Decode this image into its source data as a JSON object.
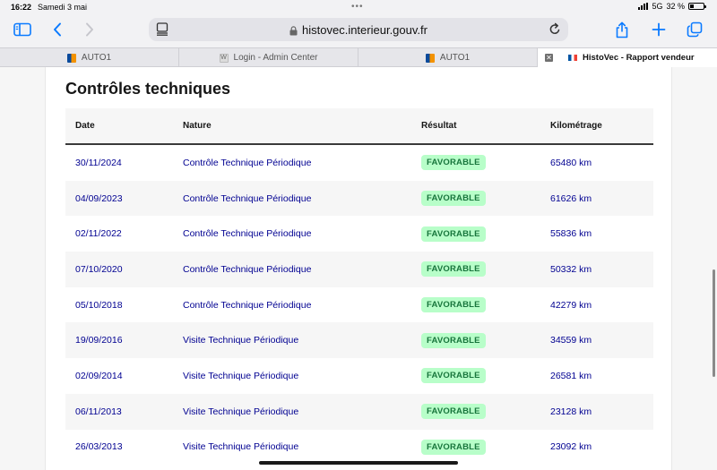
{
  "status": {
    "time": "16:22",
    "date": "Samedi 3 mai",
    "network": "5G",
    "battery": "32 %",
    "battery_level": 0.32
  },
  "address_bar": {
    "url": "histovec.interieur.gouv.fr"
  },
  "tabs": [
    {
      "label": "AUTO1"
    },
    {
      "label": "Login - Admin Center"
    },
    {
      "label": "AUTO1"
    },
    {
      "label": "HistoVec - Rapport vendeur"
    }
  ],
  "section": {
    "title": "Contrôles techniques"
  },
  "table": {
    "headers": {
      "date": "Date",
      "nature": "Nature",
      "result": "Résultat",
      "mileage": "Kilométrage"
    },
    "rows": [
      {
        "date": "30/11/2024",
        "nature": "Contrôle Technique Périodique",
        "result": "FAVORABLE",
        "mileage": "65480 km"
      },
      {
        "date": "04/09/2023",
        "nature": "Contrôle Technique Périodique",
        "result": "FAVORABLE",
        "mileage": "61626 km"
      },
      {
        "date": "02/11/2022",
        "nature": "Contrôle Technique Périodique",
        "result": "FAVORABLE",
        "mileage": "55836 km"
      },
      {
        "date": "07/10/2020",
        "nature": "Contrôle Technique Périodique",
        "result": "FAVORABLE",
        "mileage": "50332 km"
      },
      {
        "date": "05/10/2018",
        "nature": "Contrôle Technique Périodique",
        "result": "FAVORABLE",
        "mileage": "42279 km"
      },
      {
        "date": "19/09/2016",
        "nature": "Visite Technique Périodique",
        "result": "FAVORABLE",
        "mileage": "34559 km"
      },
      {
        "date": "02/09/2014",
        "nature": "Visite Technique Périodique",
        "result": "FAVORABLE",
        "mileage": "26581 km"
      },
      {
        "date": "06/11/2013",
        "nature": "Visite Technique Périodique",
        "result": "FAVORABLE",
        "mileage": "23128 km"
      },
      {
        "date": "26/03/2013",
        "nature": "Visite Technique Périodique",
        "result": "FAVORABLE",
        "mileage": "23092 km"
      }
    ]
  },
  "colors": {
    "accent": "#0a7aff",
    "link": "#000091",
    "badge_bg": "#b8fec9",
    "badge_text": "#18753c"
  },
  "icons": {
    "sidebar": "sidebar-icon",
    "back": "chevron-left-icon",
    "forward": "chevron-right-icon",
    "reader": "reader-icon",
    "lock": "lock-icon",
    "reload": "reload-icon",
    "share": "share-icon",
    "new_tab": "plus-icon",
    "tabs": "tabs-overview-icon"
  }
}
